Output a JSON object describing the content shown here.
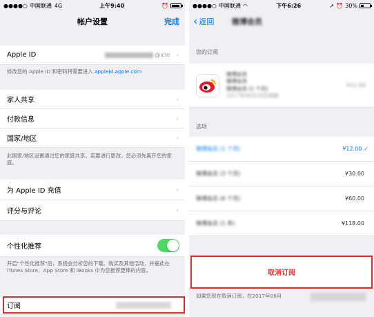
{
  "left": {
    "status": {
      "carrier": "中国联通",
      "network": "4G",
      "time": "上午9:40"
    },
    "nav": {
      "title": "帐户设置",
      "done": "完成"
    },
    "apple_id": {
      "label": "Apple ID",
      "value": "@iclo",
      "note_prefix": "修改您的 Apple ID 和密码将需要进入 ",
      "note_link": "appleid.apple.com"
    },
    "group1": [
      "家人共享",
      "付款信息",
      "国家/地区"
    ],
    "region_note": "此国家/地区设置通过您的家庭共享。若要进行更改，您必须先离开您的家庭。",
    "group2": [
      "为 Apple ID 充值",
      "评分与评论"
    ],
    "personalized": {
      "label": "个性化推荐",
      "enabled": true
    },
    "personalized_note": "开启\"个性化推荐\"后，系统会分析您的下载、购买及其他活动，并据此在 iTunes Store、App Store 和 iBooks 中为您推荐更棒的内容。",
    "subscription": {
      "label": "订阅"
    }
  },
  "right": {
    "status": {
      "carrier": "中国联通",
      "time": "下午6:26",
      "battery": "30%",
      "battery_level": 0.3
    },
    "nav": {
      "back": "返回",
      "title": "微博会员"
    },
    "your_subscription_header": "您的订阅",
    "subscription_item": {
      "name": "微博会员",
      "detail1": "微博会员",
      "detail2": "微博会员 (1 个月)",
      "detail3": "2017年06月16日续期",
      "price": "¥12.00"
    },
    "options_header": "选项",
    "options": [
      {
        "label": "微博会员 (1 个月)",
        "price": "¥12.00",
        "selected": true
      },
      {
        "label": "微博会员 (3 个月)",
        "price": "¥30.00",
        "selected": false
      },
      {
        "label": "微博会员 (6 个月)",
        "price": "¥60.00",
        "selected": false
      },
      {
        "label": "微博会员 (1 年)",
        "price": "¥118.00",
        "selected": false
      }
    ],
    "cancel_label": "取消订阅",
    "footer_note": "如果您现在取消订阅，在2017年06月"
  },
  "colors": {
    "accent": "#007aff",
    "highlight_red": "#e12a2a",
    "toggle_on": "#4cd964"
  }
}
